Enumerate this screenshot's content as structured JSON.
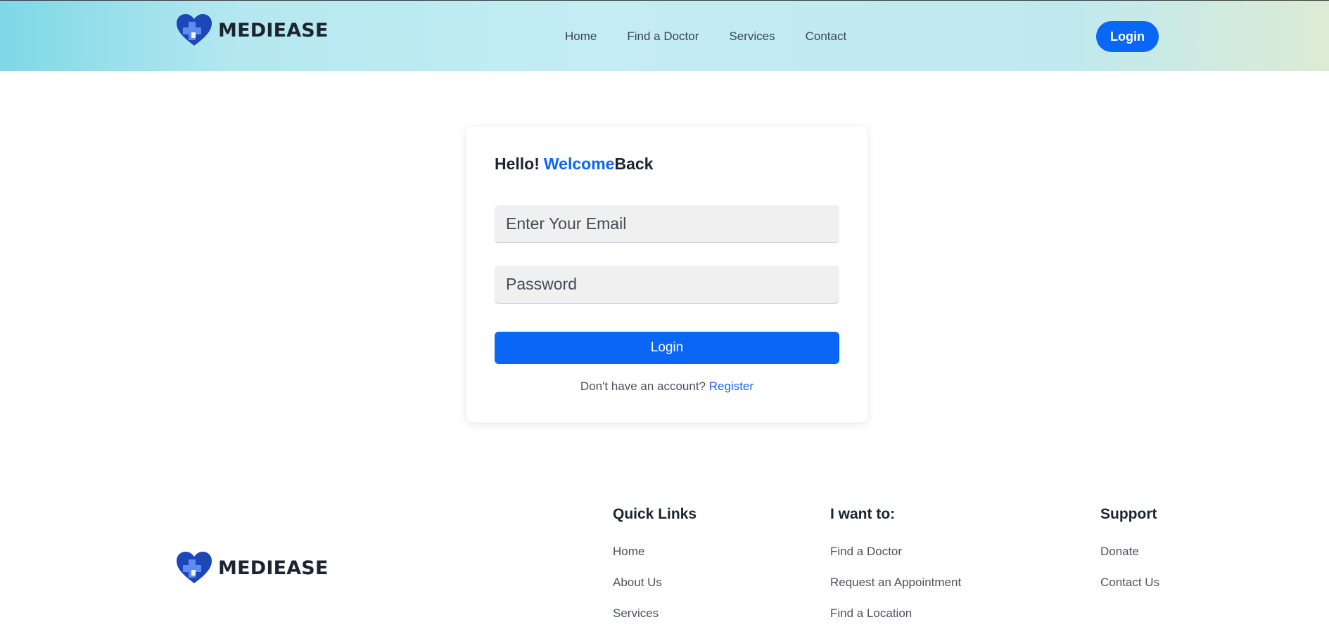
{
  "brand": {
    "name": "MEDIEASE",
    "logo_icon": "heart-cross-icon",
    "color_primary": "#0a66f5",
    "color_logo_dark": "#1d46b8",
    "color_logo_light": "#5b8cf0"
  },
  "header": {
    "nav": [
      "Home",
      "Find a Doctor",
      "Services",
      "Contact"
    ],
    "login_label": "Login"
  },
  "login_card": {
    "greeting_prefix": "Hello!",
    "greeting_accent": "Welcome",
    "greeting_suffix": "Back",
    "email_placeholder": "Enter Your Email",
    "password_placeholder": "Password",
    "submit_label": "Login",
    "register_prompt": "Don't have an account?",
    "register_link": "Register"
  },
  "footer": {
    "columns": [
      {
        "title": "Quick Links",
        "links": [
          "Home",
          "About Us",
          "Services"
        ]
      },
      {
        "title": "I want to:",
        "links": [
          "Find a Doctor",
          "Request an Appointment",
          "Find a Location"
        ]
      },
      {
        "title": "Support",
        "links": [
          "Donate",
          "Contact Us"
        ]
      }
    ]
  }
}
